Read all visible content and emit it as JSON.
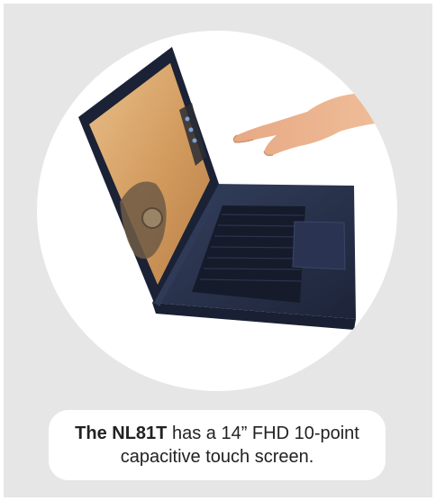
{
  "card": {
    "background": "#e6e6e6"
  },
  "image": {
    "subject": "laptop-touch-icon",
    "alt": ""
  },
  "caption": {
    "strong": "The NL81T",
    "rest": " has a 14” FHD 10-point capacitive touch screen."
  },
  "colors": {
    "laptop_body": "#26304a",
    "screen_desert": "#d6a36a",
    "hand_skin": "#e9b08a",
    "caption_text": "#222222"
  }
}
